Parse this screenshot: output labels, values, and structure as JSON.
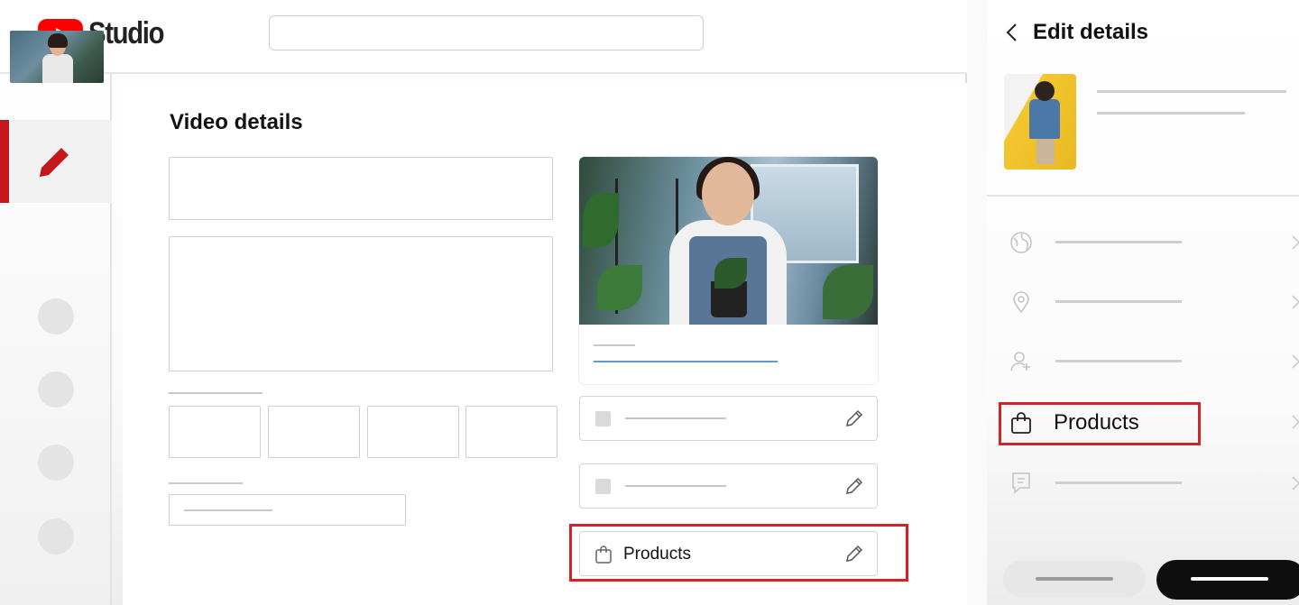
{
  "app": {
    "name": "Studio"
  },
  "main": {
    "title": "Video details"
  },
  "desktop_cards": {
    "products_label": "Products"
  },
  "mobile": {
    "title": "Edit details",
    "menu": [
      {
        "icon": "globe-icon",
        "label": ""
      },
      {
        "icon": "location-pin-icon",
        "label": ""
      },
      {
        "icon": "person-add-icon",
        "label": ""
      },
      {
        "icon": "shopping-bag-icon",
        "label": "Products"
      },
      {
        "icon": "comment-icon",
        "label": ""
      }
    ]
  },
  "colors": {
    "brand_red": "#ff0000",
    "highlight": "#d3222a",
    "active_rail": "#c3171c",
    "link_blue": "#5b9bd5"
  }
}
